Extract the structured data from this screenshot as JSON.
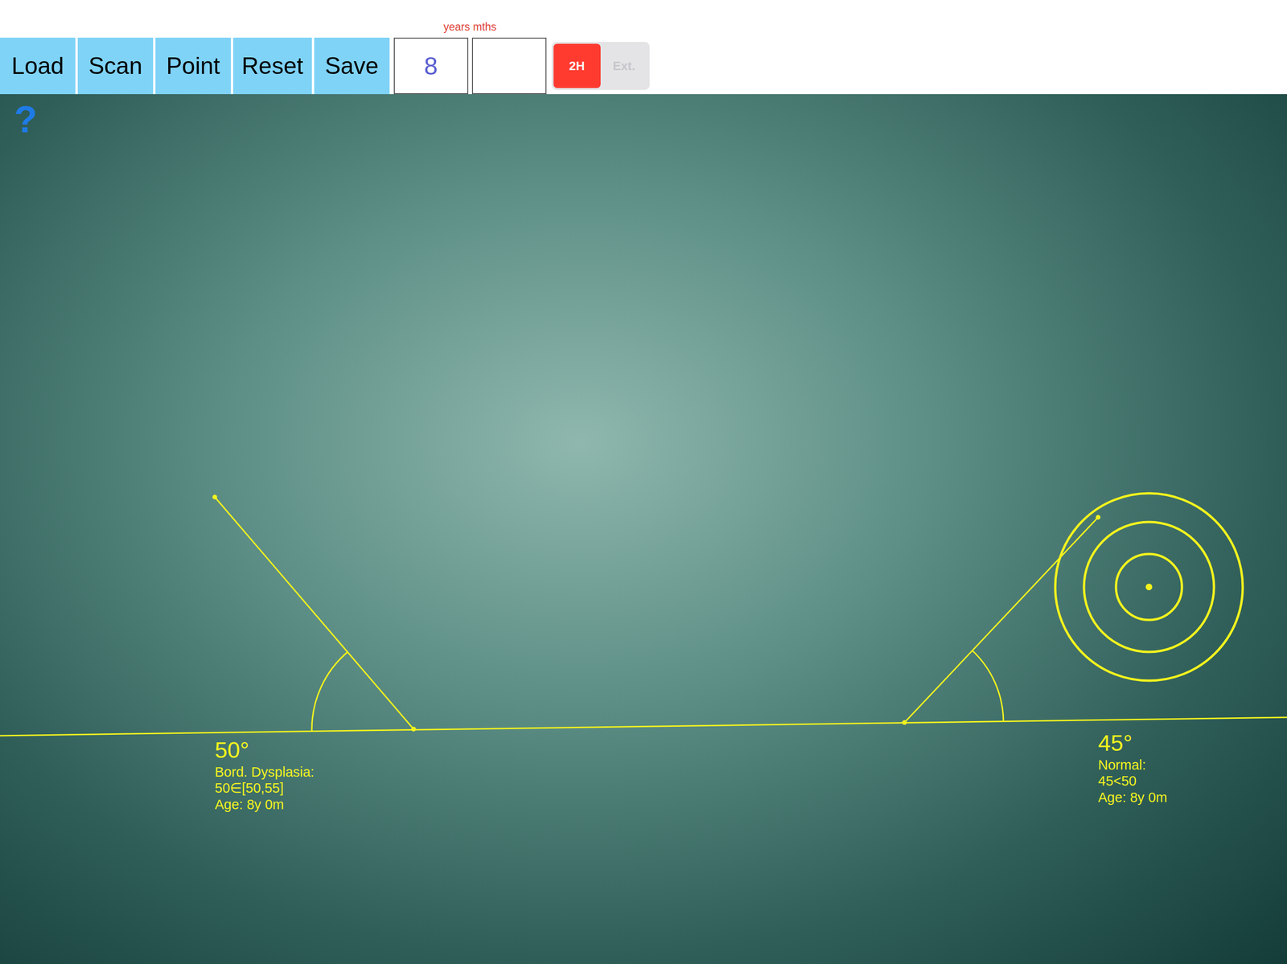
{
  "toolbar": {
    "buttons": [
      {
        "label": "Load"
      },
      {
        "label": "Scan"
      },
      {
        "label": "Point"
      },
      {
        "label": "Reset"
      },
      {
        "label": "Save"
      }
    ]
  },
  "age": {
    "caption": "years mths",
    "years": "8",
    "months": ""
  },
  "mode_toggle": [
    {
      "label": "2H",
      "selected": true
    },
    {
      "label": "Ext.",
      "selected": false
    }
  ],
  "help": "?",
  "measurements": [
    {
      "angle": "50°",
      "status": "Bord. Dysplasia:",
      "range": "50∈[50,55]",
      "age": "Age: 8y 0m",
      "selected": false
    },
    {
      "angle": "45°",
      "status": "Normal:",
      "range": "45<50",
      "age": "Age: 8y 0m",
      "selected": true
    }
  ]
}
